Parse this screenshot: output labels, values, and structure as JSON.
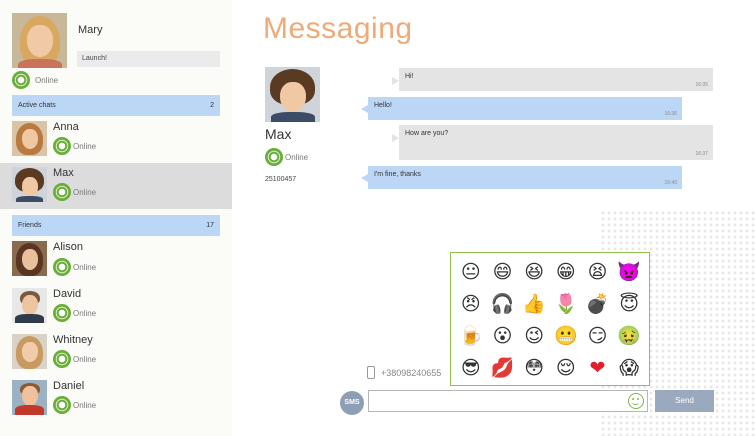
{
  "me": {
    "name": "Mary",
    "mood": "Launch!",
    "status": "Online"
  },
  "active_chats": {
    "label": "Active chats",
    "count": "2"
  },
  "active_contacts": [
    {
      "name": "Anna",
      "status": "Online"
    },
    {
      "name": "Max",
      "status": "Online"
    }
  ],
  "friends": {
    "label": "Friends",
    "count": "17"
  },
  "friend_contacts": [
    {
      "name": "Alison",
      "status": "Online"
    },
    {
      "name": "David",
      "status": "Online"
    },
    {
      "name": "Whitney",
      "status": "Online"
    },
    {
      "name": "Daniel",
      "status": "Online"
    }
  ],
  "title": "Messaging",
  "peer": {
    "name": "Max",
    "status": "Online",
    "phone": "25100457"
  },
  "messages": [
    {
      "text": "Hi!",
      "time": "16:35",
      "direction": "in"
    },
    {
      "text": "Hello!",
      "time": "16:36",
      "direction": "out"
    },
    {
      "text": "How are you?",
      "time": "16:37",
      "direction": "in"
    },
    {
      "text": "I'm fine, thanks",
      "time": "16:40",
      "direction": "out"
    }
  ],
  "emoji_panel": {
    "icons": [
      "😐",
      "😄",
      "😆",
      "😁",
      "😫",
      "👿",
      "😠",
      "🎧",
      "👍",
      "🌷",
      "💣",
      "😇",
      "🍺",
      "😮",
      "😉",
      "😬",
      "😏",
      "🤢",
      "😎",
      "💋",
      "😳",
      "😌",
      "❤",
      "😱"
    ]
  },
  "sms_phone": "+38098240655",
  "composer": {
    "sms_label": "SMS",
    "send_label": "Send",
    "input_value": ""
  },
  "colors": {
    "title": "#f0a978",
    "bubble_out": "#bcd6f5",
    "bubble_in": "#e4e4e4",
    "online": "#6aad3a"
  }
}
